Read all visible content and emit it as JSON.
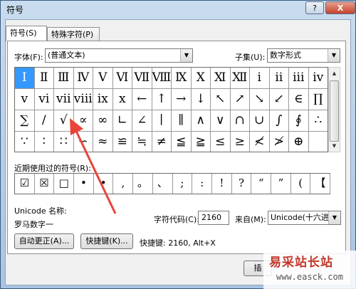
{
  "window": {
    "title": "符号",
    "help_label": "?",
    "close_label": "X"
  },
  "tabs": [
    {
      "label": "符号(S)"
    },
    {
      "label": "特殊字符(P)"
    }
  ],
  "font": {
    "label": "字体(F):",
    "value": "(普通文本)"
  },
  "subset": {
    "label": "子集(U):",
    "value": "数字形式"
  },
  "grid": {
    "rows": [
      [
        "Ⅰ",
        "Ⅱ",
        "Ⅲ",
        "Ⅳ",
        "Ⅴ",
        "Ⅵ",
        "Ⅶ",
        "Ⅷ",
        "Ⅸ",
        "Ⅹ",
        "Ⅺ",
        "Ⅻ",
        "ⅰ",
        "ⅱ",
        "ⅲ",
        "ⅳ"
      ],
      [
        "ⅴ",
        "ⅵ",
        "ⅶ",
        "ⅷ",
        "ⅸ",
        "ⅹ",
        "←",
        "↑",
        "→",
        "↓",
        "↖",
        "↗",
        "↘",
        "↙",
        "∈",
        "∏"
      ],
      [
        "∑",
        "/",
        "√",
        "∝",
        "∞",
        "∟",
        "∠",
        "∣",
        "∥",
        "∧",
        "∨",
        "∩",
        "∪",
        "∫",
        "∮",
        "∴"
      ],
      [
        "∵",
        "∶",
        "∷",
        "∽",
        "≈",
        "≌",
        "≒",
        "≠",
        "≦",
        "≧",
        "≤",
        "≥",
        "≮",
        "≯",
        "⊕",
        ""
      ]
    ],
    "selected": "0.0"
  },
  "recent": {
    "label": "近期使用过的符号(R):",
    "items": [
      "☑",
      "☒",
      "□",
      "•",
      "•",
      ",",
      "。",
      "、",
      ";",
      ":",
      "!",
      "?",
      "“",
      "”",
      "(",
      "【"
    ]
  },
  "unicode_name": {
    "label": "Unicode 名称:",
    "value": "罗马数字一"
  },
  "char_code": {
    "label": "字符代码(C):",
    "value": "2160"
  },
  "from": {
    "label": "来自(M):",
    "value": "Unicode(十六进"
  },
  "buttons": {
    "autocorrect": "自动更正(A)...",
    "shortcut_key": "快捷键(K)...",
    "insert": "插"
  },
  "shortcut_text": "快捷键: 2160, Alt+X",
  "watermark": {
    "line1": "易采站长站",
    "line2": "www.easck.com"
  },
  "colors": {
    "selection": "#3399ff",
    "arrow": "#e8443a"
  }
}
